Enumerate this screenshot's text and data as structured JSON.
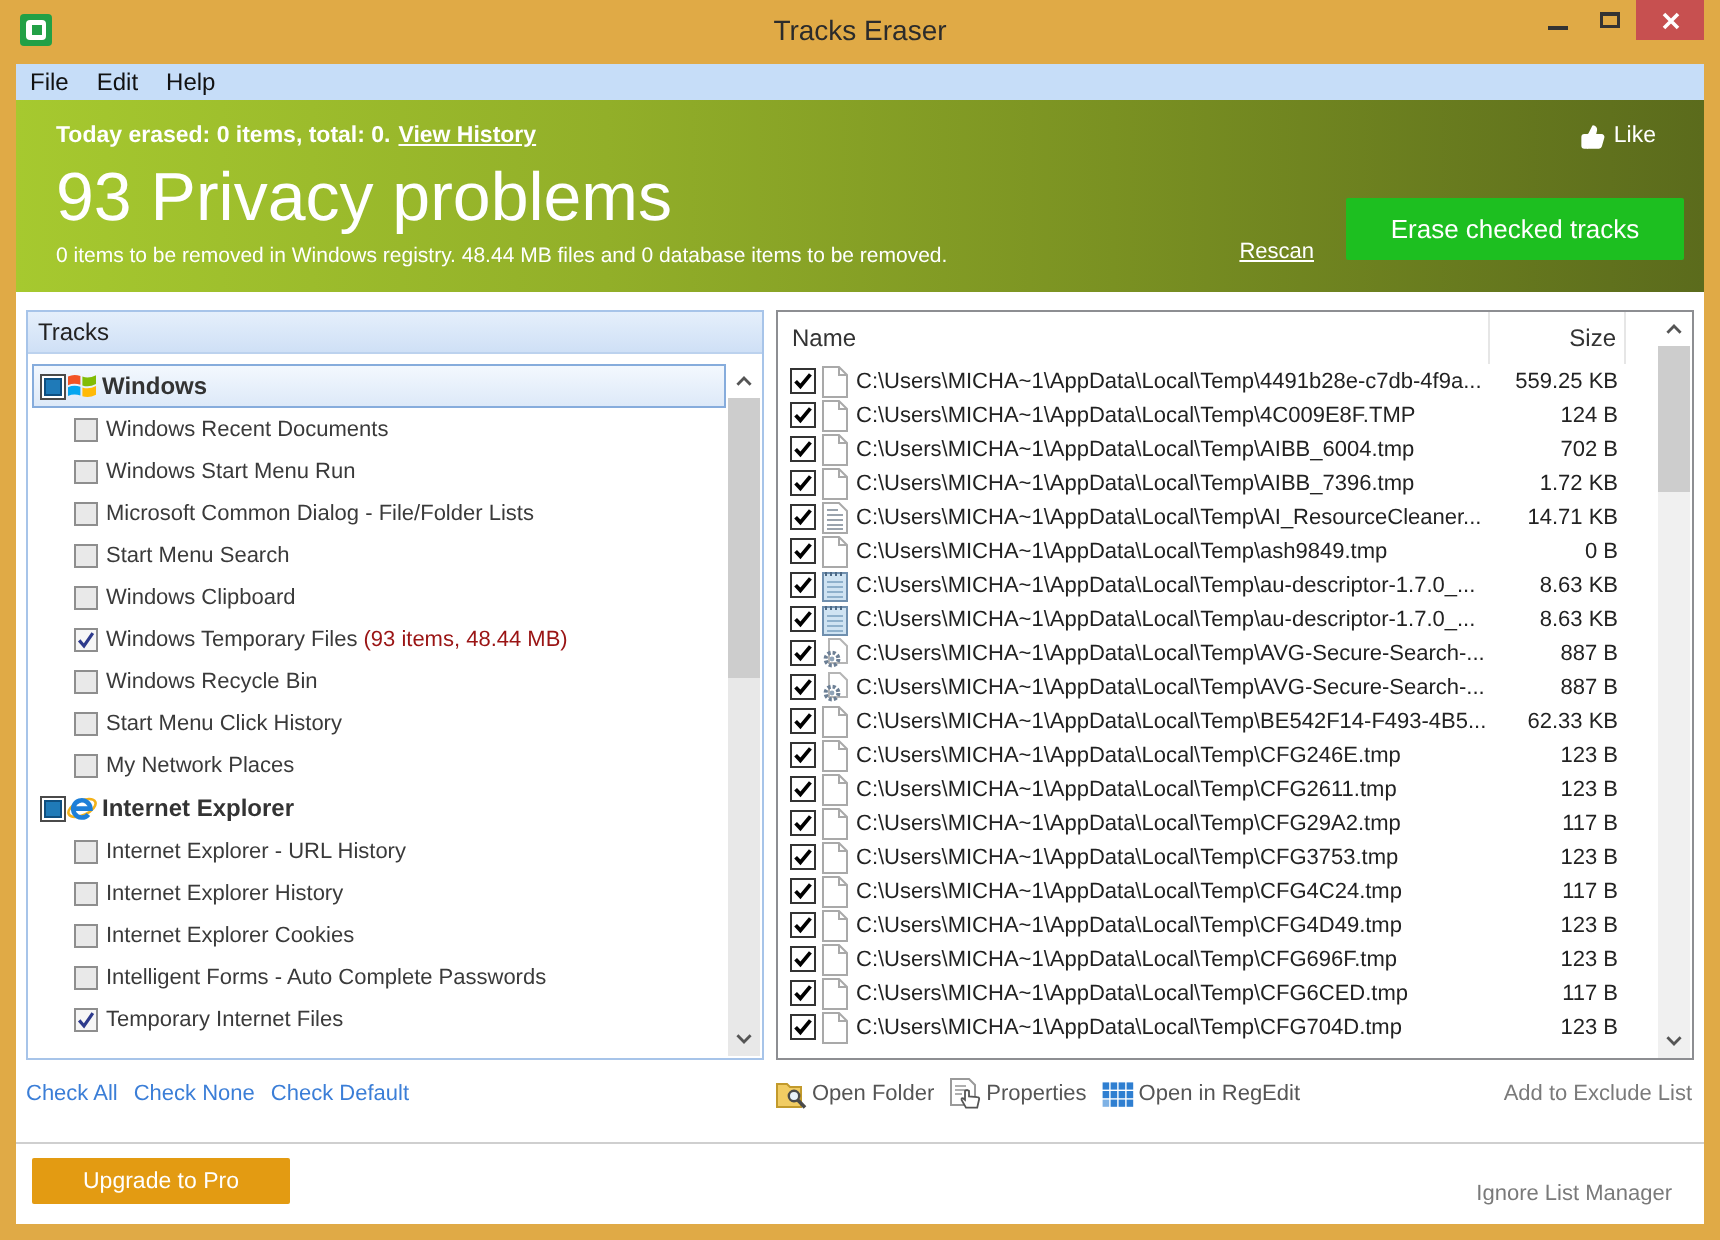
{
  "window": {
    "title": "Tracks Eraser"
  },
  "menu": [
    "File",
    "Edit",
    "Help"
  ],
  "banner": {
    "today": "Today erased: 0 items, total: 0.",
    "history_link": "View History",
    "like": "Like",
    "headline": "93 Privacy problems",
    "summary": "0 items to be removed in Windows registry. 48.44 MB files and 0 database items to be removed.",
    "rescan": "Rescan",
    "erase_button": "Erase checked tracks"
  },
  "tracks": {
    "header": "Tracks",
    "groups": [
      {
        "label": "Windows",
        "kind": "windows",
        "selected": true,
        "indeterminate": true,
        "children": [
          {
            "label": "Windows Recent Documents",
            "checked": false
          },
          {
            "label": "Windows Start Menu Run",
            "checked": false
          },
          {
            "label": "Microsoft Common Dialog - File/Folder Lists",
            "checked": false
          },
          {
            "label": "Start Menu Search",
            "checked": false
          },
          {
            "label": "Windows Clipboard",
            "checked": false
          },
          {
            "label": "Windows Temporary Files",
            "detail": "(93 items, 48.44 MB)",
            "checked": true
          },
          {
            "label": "Windows Recycle Bin",
            "checked": false
          },
          {
            "label": "Start Menu Click History",
            "checked": false
          },
          {
            "label": "My Network Places",
            "checked": false
          }
        ]
      },
      {
        "label": "Internet Explorer",
        "kind": "ie",
        "selected": false,
        "indeterminate": true,
        "children": [
          {
            "label": "Internet Explorer - URL History",
            "checked": false
          },
          {
            "label": "Internet Explorer History",
            "checked": false
          },
          {
            "label": "Internet Explorer Cookies",
            "checked": false
          },
          {
            "label": "Intelligent Forms - Auto Complete Passwords",
            "checked": false
          },
          {
            "label": "Temporary Internet Files",
            "checked": true
          }
        ]
      }
    ]
  },
  "files": {
    "columns": [
      "Name",
      "Size"
    ],
    "rows": [
      {
        "checked": true,
        "kind": "file",
        "path": "C:\\Users\\MICHA~1\\AppData\\Local\\Temp\\4491b28e-c7db-4f9a...",
        "size": "559.25 KB"
      },
      {
        "checked": true,
        "kind": "file",
        "path": "C:\\Users\\MICHA~1\\AppData\\Local\\Temp\\4C009E8F.TMP",
        "size": "124 B"
      },
      {
        "checked": true,
        "kind": "file",
        "path": "C:\\Users\\MICHA~1\\AppData\\Local\\Temp\\AIBB_6004.tmp",
        "size": "702 B"
      },
      {
        "checked": true,
        "kind": "file",
        "path": "C:\\Users\\MICHA~1\\AppData\\Local\\Temp\\AIBB_7396.tmp",
        "size": "1.72 KB"
      },
      {
        "checked": true,
        "kind": "text",
        "path": "C:\\Users\\MICHA~1\\AppData\\Local\\Temp\\AI_ResourceCleaner...",
        "size": "14.71 KB"
      },
      {
        "checked": true,
        "kind": "file",
        "path": "C:\\Users\\MICHA~1\\AppData\\Local\\Temp\\ash9849.tmp",
        "size": "0 B"
      },
      {
        "checked": true,
        "kind": "notepad",
        "path": "C:\\Users\\MICHA~1\\AppData\\Local\\Temp\\au-descriptor-1.7.0_...",
        "size": "8.63 KB"
      },
      {
        "checked": true,
        "kind": "notepad",
        "path": "C:\\Users\\MICHA~1\\AppData\\Local\\Temp\\au-descriptor-1.7.0_...",
        "size": "8.63 KB"
      },
      {
        "checked": true,
        "kind": "settings",
        "path": "C:\\Users\\MICHA~1\\AppData\\Local\\Temp\\AVG-Secure-Search-...",
        "size": "887 B"
      },
      {
        "checked": true,
        "kind": "settings",
        "path": "C:\\Users\\MICHA~1\\AppData\\Local\\Temp\\AVG-Secure-Search-...",
        "size": "887 B"
      },
      {
        "checked": true,
        "kind": "file",
        "path": "C:\\Users\\MICHA~1\\AppData\\Local\\Temp\\BE542F14-F493-4B5...",
        "size": "62.33 KB"
      },
      {
        "checked": true,
        "kind": "file",
        "path": "C:\\Users\\MICHA~1\\AppData\\Local\\Temp\\CFG246E.tmp",
        "size": "123 B"
      },
      {
        "checked": true,
        "kind": "file",
        "path": "C:\\Users\\MICHA~1\\AppData\\Local\\Temp\\CFG2611.tmp",
        "size": "123 B"
      },
      {
        "checked": true,
        "kind": "file",
        "path": "C:\\Users\\MICHA~1\\AppData\\Local\\Temp\\CFG29A2.tmp",
        "size": "117 B"
      },
      {
        "checked": true,
        "kind": "file",
        "path": "C:\\Users\\MICHA~1\\AppData\\Local\\Temp\\CFG3753.tmp",
        "size": "123 B"
      },
      {
        "checked": true,
        "kind": "file",
        "path": "C:\\Users\\MICHA~1\\AppData\\Local\\Temp\\CFG4C24.tmp",
        "size": "117 B"
      },
      {
        "checked": true,
        "kind": "file",
        "path": "C:\\Users\\MICHA~1\\AppData\\Local\\Temp\\CFG4D49.tmp",
        "size": "123 B"
      },
      {
        "checked": true,
        "kind": "file",
        "path": "C:\\Users\\MICHA~1\\AppData\\Local\\Temp\\CFG696F.tmp",
        "size": "123 B"
      },
      {
        "checked": true,
        "kind": "file",
        "path": "C:\\Users\\MICHA~1\\AppData\\Local\\Temp\\CFG6CED.tmp",
        "size": "117 B"
      },
      {
        "checked": true,
        "kind": "file",
        "path": "C:\\Users\\MICHA~1\\AppData\\Local\\Temp\\CFG704D.tmp",
        "size": "123 B"
      }
    ]
  },
  "track_links": [
    "Check All",
    "Check None",
    "Check Default"
  ],
  "file_actions": [
    {
      "kind": "folder",
      "label": "Open Folder"
    },
    {
      "kind": "properties",
      "label": "Properties"
    },
    {
      "kind": "regedit",
      "label": "Open in RegEdit"
    }
  ],
  "exclude_link": {
    "label": "Add to Exclude List",
    "disabled": true
  },
  "footer": {
    "upgrade_button": "Upgrade to Pro",
    "ignore_link": {
      "label": "Ignore List Manager",
      "disabled": true
    }
  }
}
